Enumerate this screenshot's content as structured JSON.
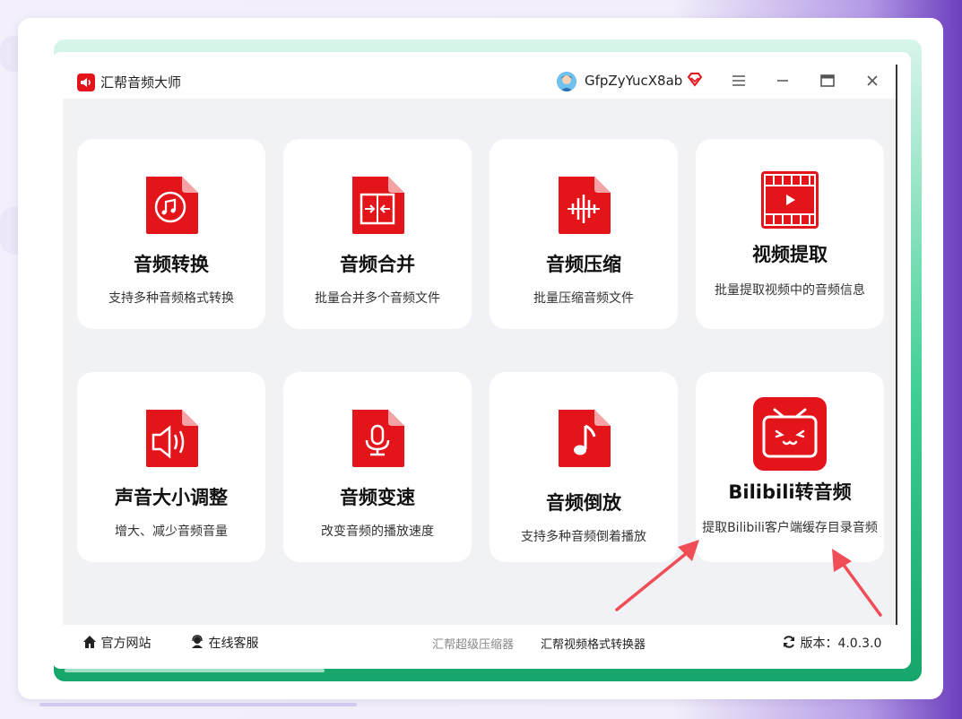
{
  "app": {
    "title": "汇帮音频大师"
  },
  "user": {
    "name": "GfpZyYucX8ab"
  },
  "window_controls": [
    "menu-icon",
    "minimize-icon",
    "maximize-icon",
    "close-icon"
  ],
  "colors": {
    "brand_red": "#e3151b",
    "accent_green": "#16a56b"
  },
  "features": [
    {
      "title": "音频转换",
      "desc": "支持多种音频格式转换",
      "icon": "audio-convert-icon"
    },
    {
      "title": "音频合并",
      "desc": "批量合并多个音频文件",
      "icon": "audio-merge-icon"
    },
    {
      "title": "音频压缩",
      "desc": "批量压缩音频文件",
      "icon": "audio-compress-icon"
    },
    {
      "title": "视频提取",
      "desc": "批量提取视频中的音频信息",
      "icon": "video-extract-icon"
    },
    {
      "title": "声音大小调整",
      "desc": "增大、减少音频音量",
      "icon": "volume-adjust-icon"
    },
    {
      "title": "音频变速",
      "desc": "改变音频的播放速度",
      "icon": "audio-speed-icon"
    },
    {
      "title": "音频倒放",
      "desc": "支持多种音频倒着播放",
      "icon": "audio-reverse-icon"
    },
    {
      "title": "Bilibili转音频",
      "desc": "提取Bilibili客户端缓存目录音频",
      "icon": "bilibili-icon"
    }
  ],
  "footer": {
    "website": "官方网站",
    "support": "在线客服",
    "link1": "汇帮超级压缩器",
    "link2": "汇帮视频格式转换器",
    "version": "版本：4.0.3.0"
  }
}
